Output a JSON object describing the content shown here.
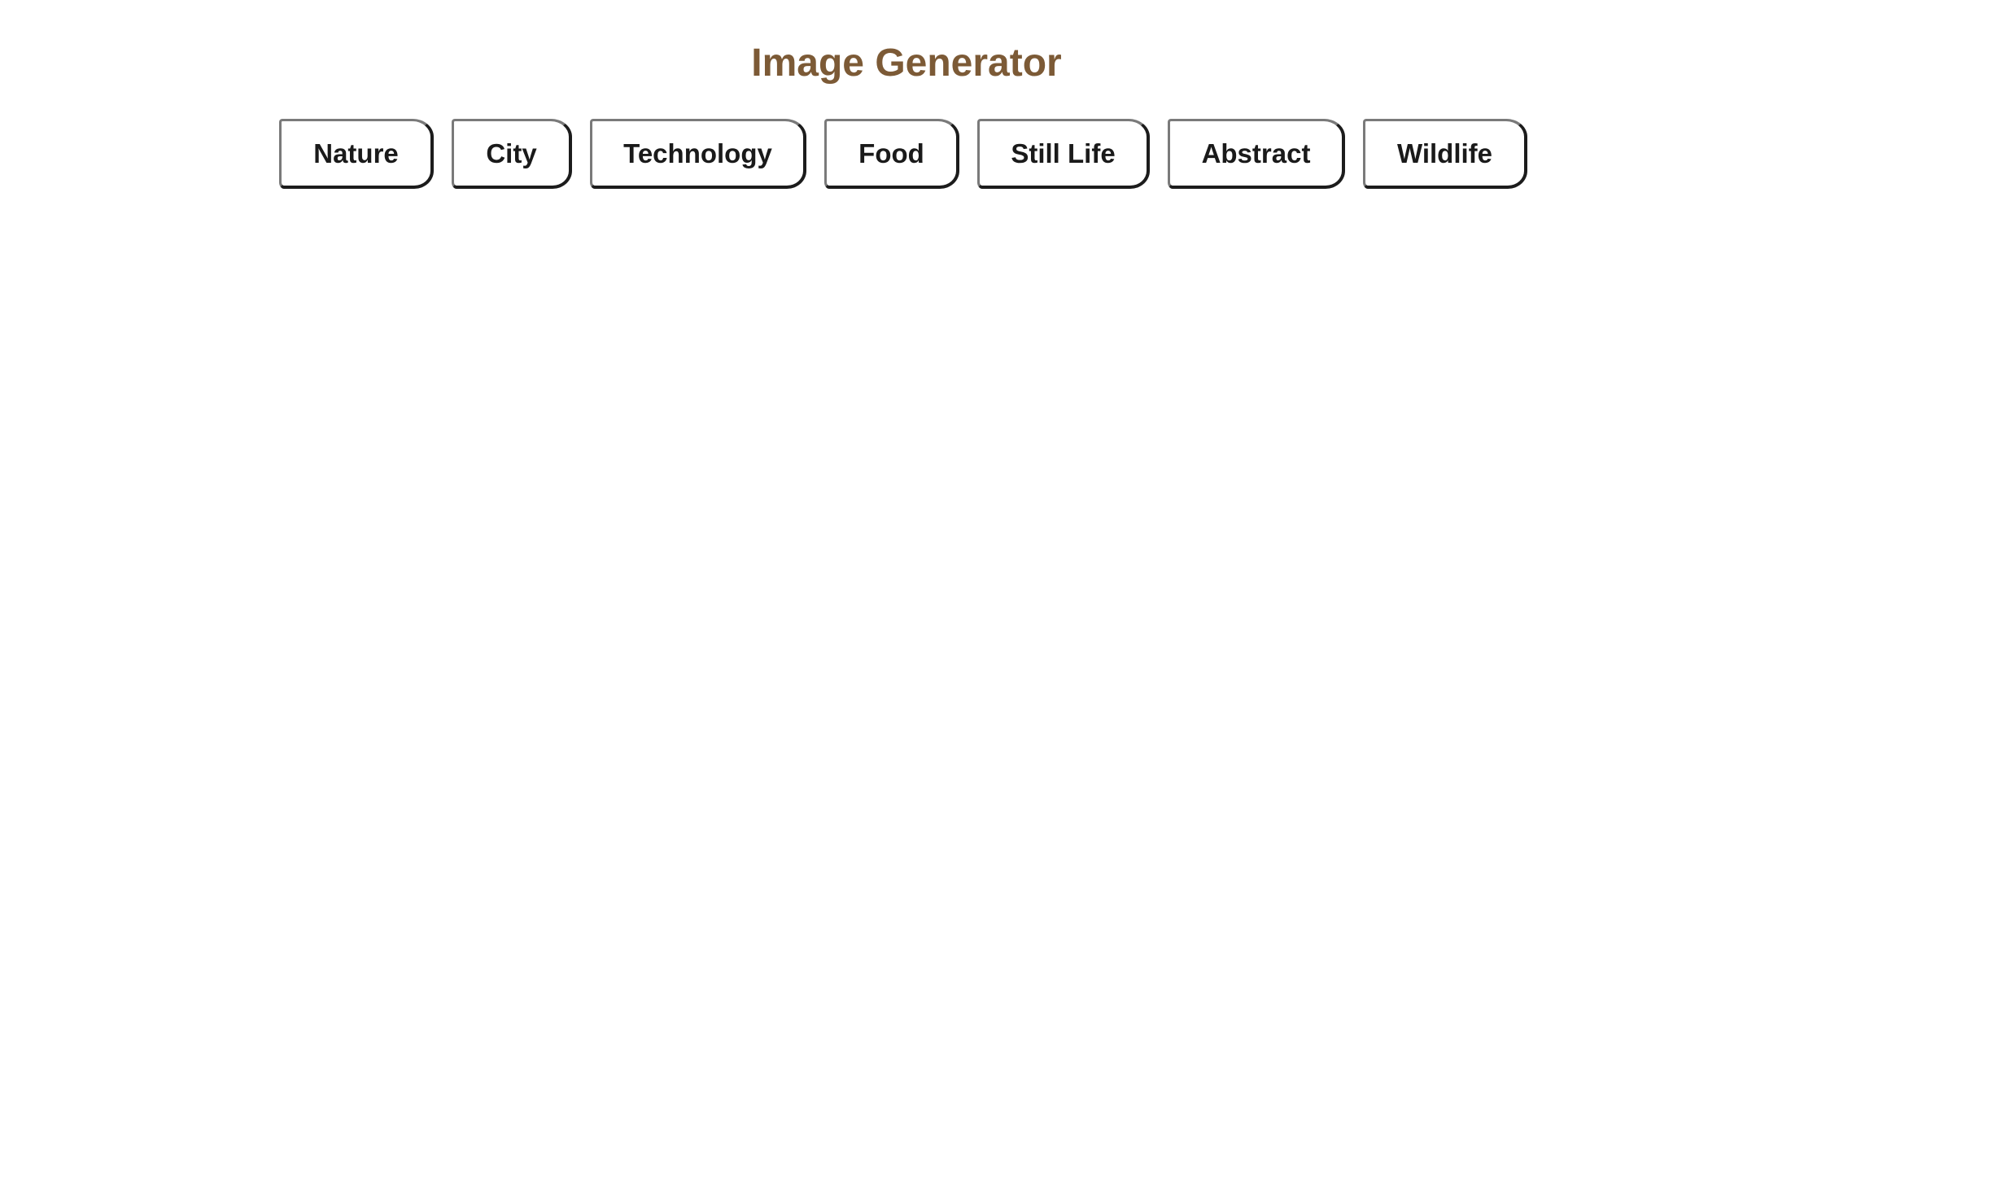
{
  "page": {
    "title": "Image Generator",
    "title_color": "#7c5a36",
    "background": "#ffffff"
  },
  "categories": [
    {
      "label": "Nature"
    },
    {
      "label": "City"
    },
    {
      "label": "Technology"
    },
    {
      "label": "Food"
    },
    {
      "label": "Still Life"
    },
    {
      "label": "Abstract"
    },
    {
      "label": "Wildlife"
    }
  ]
}
